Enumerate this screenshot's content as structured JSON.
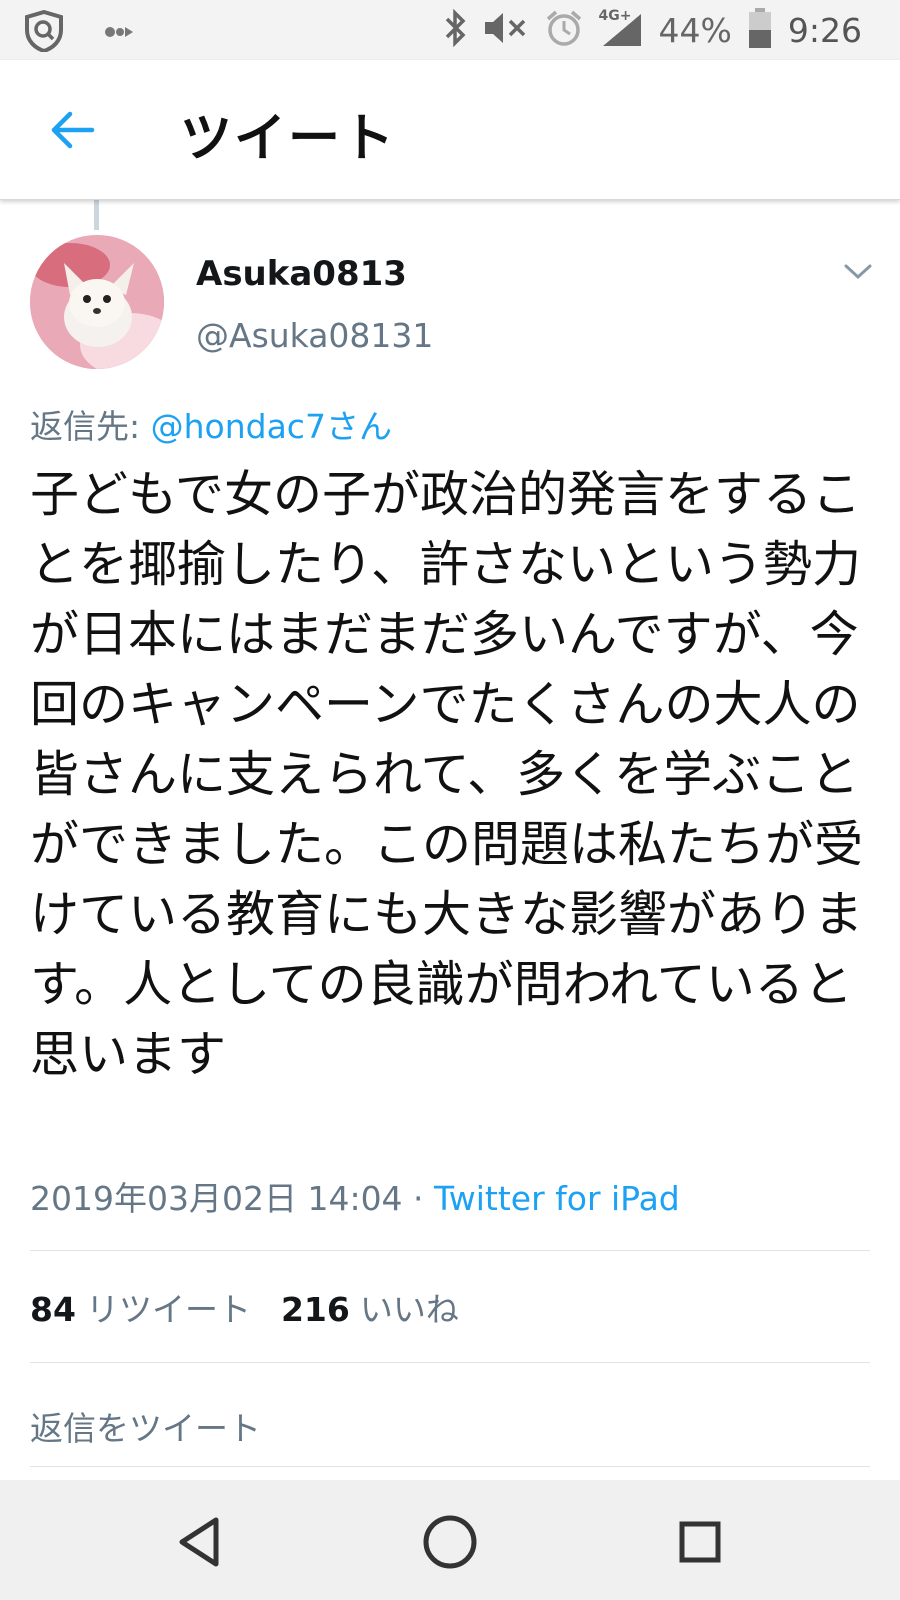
{
  "status_bar": {
    "network": "4G+",
    "battery": "44%",
    "time": "9:26"
  },
  "header": {
    "title": "ツイート"
  },
  "tweet": {
    "display_name": "Asuka0813",
    "handle": "@Asuka08131",
    "reply_prefix": "返信先: ",
    "reply_to": "@hondac7さん",
    "text": "子どもで女の子が政治的発言をすることを揶揄したり、許さないという勢力が日本にはまだまだ多いんですが、今回のキャンペーンでたくさんの大人の皆さんに支えられて、多くを学ぶことができました。この問題は私たちが受けている教育にも大きな影響があります。人としての良識が問われていると思います",
    "timestamp": "2019年03月02日 14:04",
    "separator": " · ",
    "source": "Twitter for iPad"
  },
  "stats": {
    "retweets": "84",
    "retweets_label": "リツイート",
    "likes": "216",
    "likes_label": "いいね"
  },
  "reply_box": {
    "placeholder": "返信をツイート"
  },
  "colors": {
    "accent": "#1da1f2",
    "muted": "#657786",
    "status_bar_bg": "#f3f3f3",
    "nav_bar_bg": "#f0f0f0"
  }
}
